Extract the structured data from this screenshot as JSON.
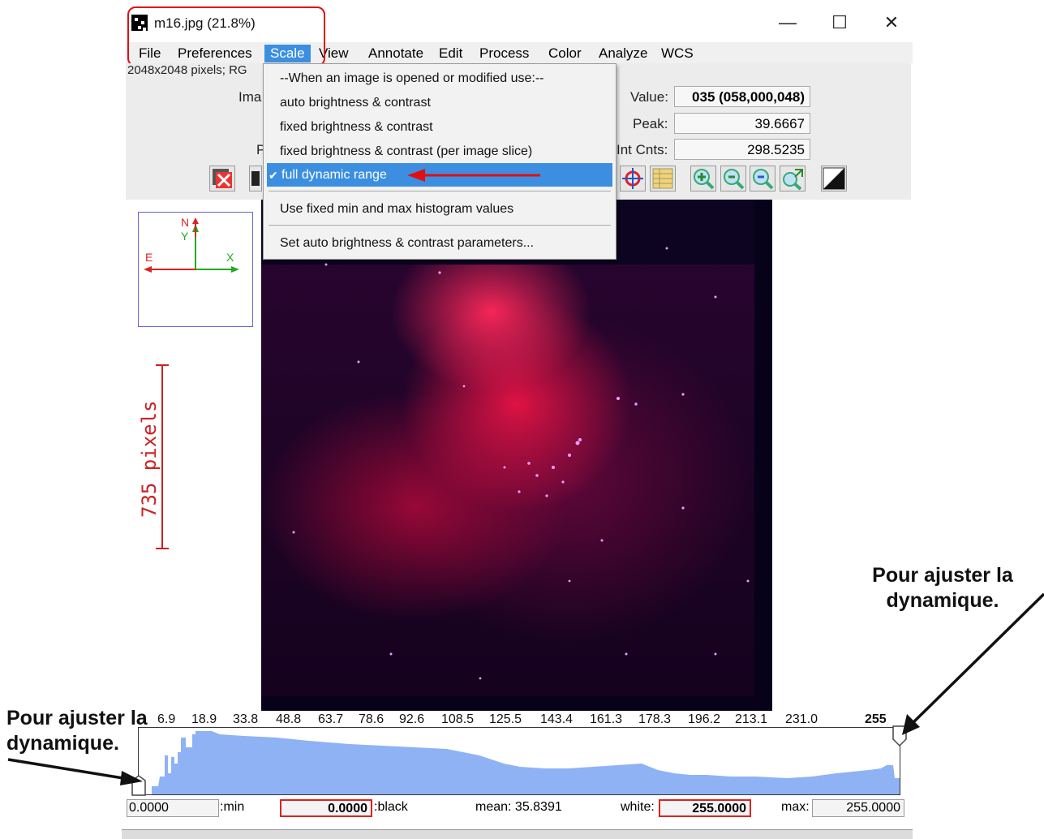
{
  "window": {
    "title": "m16.jpg (21.8%)",
    "controls": {
      "minimize": "—",
      "maximize": "☐",
      "close": "✕"
    }
  },
  "menu": {
    "items": [
      {
        "label": "File"
      },
      {
        "label": "Preferences"
      },
      {
        "label": "Scale",
        "active": true
      },
      {
        "label": "View"
      },
      {
        "label": "Annotate"
      },
      {
        "label": "Edit"
      },
      {
        "label": "Process"
      },
      {
        "label": "Color"
      },
      {
        "label": "Analyze"
      },
      {
        "label": "WCS"
      }
    ]
  },
  "image_info": "2048x2048 pixels; RG",
  "info_panel": {
    "label_ima": "Ima",
    "label_p": "P",
    "value_label": "Value:",
    "value": "035 (058,000,048)",
    "peak_label": "Peak:",
    "peak": "39.6667",
    "intcnts_label": "Int Cnts:",
    "intcnts": "298.5235"
  },
  "scale_menu": {
    "header": "--When an image is opened or modified use:--",
    "items": [
      {
        "label": "auto brightness & contrast"
      },
      {
        "label": "fixed brightness & contrast"
      },
      {
        "label": "fixed brightness & contrast (per image slice)"
      },
      {
        "label": "full dynamic range",
        "checked": true
      },
      {
        "label": "Use fixed min and max histogram values"
      },
      {
        "label": "Set auto brightness & contrast parameters..."
      }
    ],
    "check_mark": "✔"
  },
  "compass": {
    "north": "N",
    "y": "Y",
    "east": "E",
    "x": "X"
  },
  "scale_bar": "735 pixels",
  "histogram": {
    "ticks": [
      "6.9",
      "18.9",
      "33.8",
      "48.8",
      "63.7",
      "78.6",
      "92.6",
      "108.5",
      "125.5",
      "143.4",
      "161.3",
      "178.3",
      "196.2",
      "213.1",
      "231.0",
      "255"
    ],
    "fill_color": "#8fb2f5"
  },
  "stats": {
    "min_value": "0.0000",
    "min_label": ":min",
    "black_value": "0.0000",
    "black_label": ":black",
    "mean": "mean: 35.8391",
    "white_label": "white:",
    "white_value": "255.0000",
    "max_label": "max:",
    "max_value": "255.0000"
  },
  "annotations": {
    "right_note": "Pour ajuster la dynamique.",
    "left_note": "Pour ajuster la dynamique."
  },
  "colors": {
    "accent": "#3c8fe0",
    "highlight": "#e01010",
    "text_red": "#cc2222"
  }
}
